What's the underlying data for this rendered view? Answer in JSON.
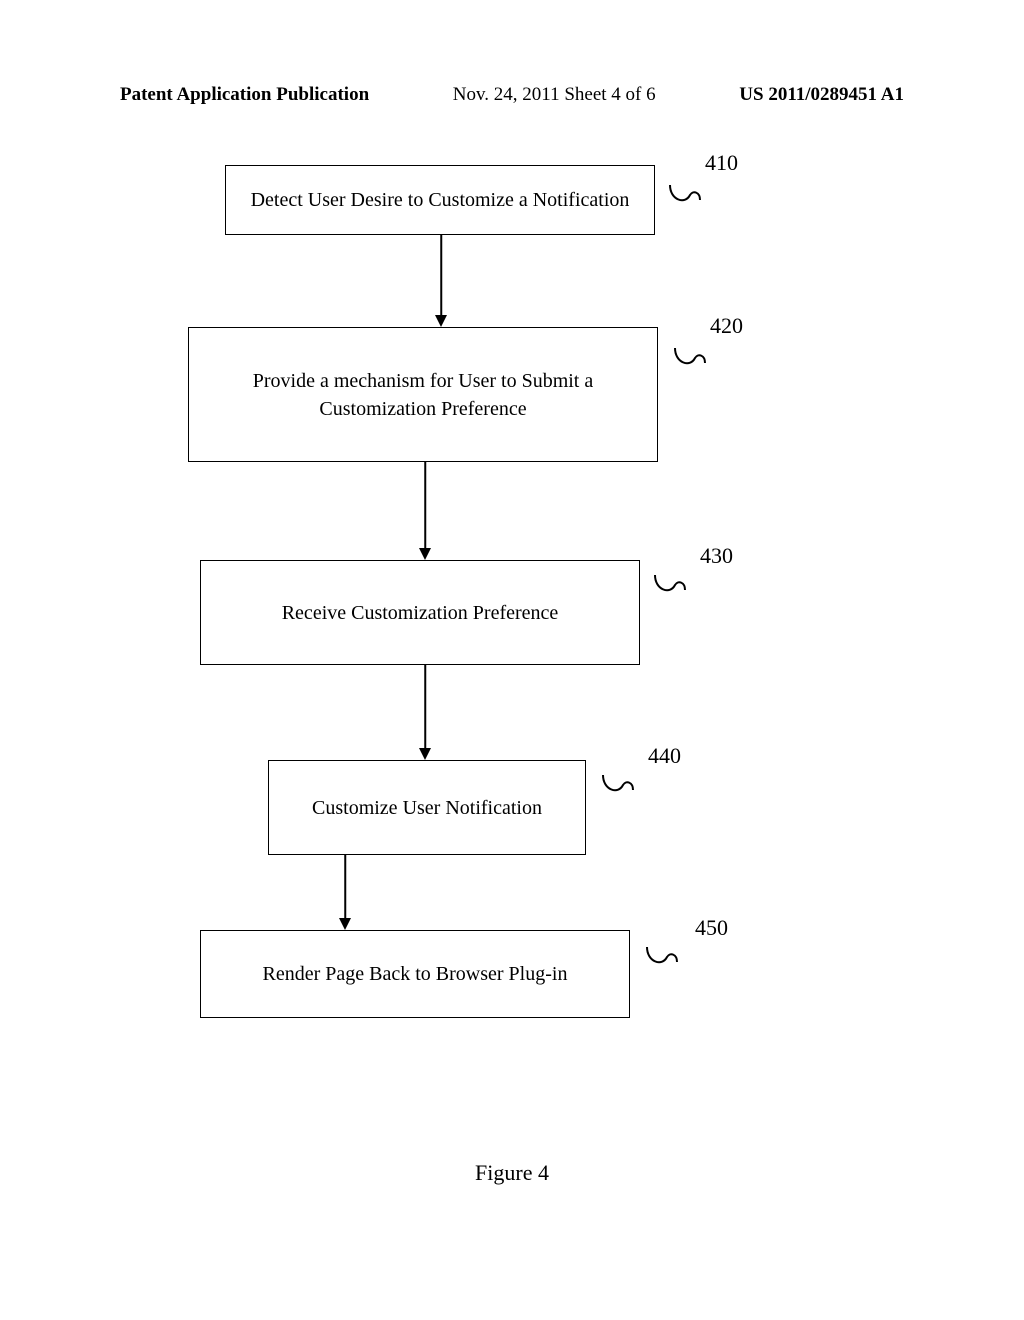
{
  "header": {
    "left": "Patent Application Publication",
    "center": "Nov. 24, 2011  Sheet 4 of 6",
    "right": "US 2011/0289451 A1"
  },
  "steps": {
    "s410": {
      "text": "Detect User Desire to Customize a Notification",
      "num": "410"
    },
    "s420": {
      "text": "Provide a mechanism for User to Submit a Customization Preference",
      "num": "420"
    },
    "s430": {
      "text": "Receive Customization Preference",
      "num": "430"
    },
    "s440": {
      "text": "Customize User Notification",
      "num": "440"
    },
    "s450": {
      "text": "Render Page Back to Browser Plug-in",
      "num": "450"
    }
  },
  "figure_caption": "Figure 4"
}
